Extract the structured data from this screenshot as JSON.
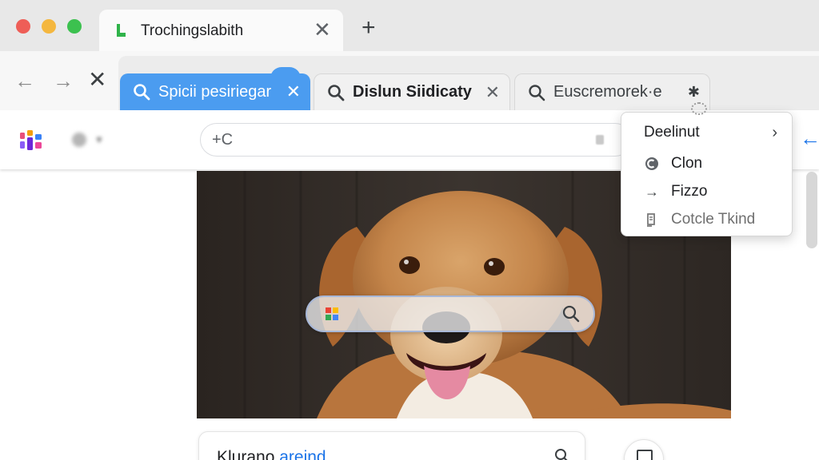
{
  "window": {
    "tab_title": "Trochingslabith",
    "close_symbol": "✕",
    "new_tab_symbol": "+"
  },
  "nav": {
    "back": "←",
    "forward": "→",
    "stop": "✕"
  },
  "page_tabs": [
    {
      "label": "Spicii pesiriegar",
      "close": "✕"
    },
    {
      "label": "Dislun Siidicaty",
      "close": "✕"
    },
    {
      "label": "Euscremorek·e",
      "close": "✱"
    }
  ],
  "toolbar": {
    "omnibox_prefix": "+C",
    "omnibox_value": "",
    "side_back": "←"
  },
  "context_menu": {
    "items": [
      {
        "label": "Deelinut",
        "arrow": "›"
      },
      {
        "label": "Clon",
        "icon": "◐"
      },
      {
        "label": "Fizzo",
        "icon": "→"
      },
      {
        "label": "Cotcle Tkind",
        "icon": "▯"
      }
    ]
  },
  "result_card": {
    "text": "Klurano",
    "link": "areind"
  },
  "colors": {
    "active_tab": "#4b9cf0",
    "accent_link": "#1a73e8",
    "traffic_red": "#ee5e57",
    "traffic_yellow": "#f4b73f",
    "traffic_green": "#3cc14f"
  },
  "icons": {
    "favicon": "green-bar-icon",
    "app_logo": "app-logo-icon",
    "search": "search-icon",
    "google_g": "google-g-icon",
    "menu_clone": "clone-icon",
    "menu_forward": "arrow-right-icon",
    "menu_doc": "document-icon",
    "round_button": "bookmark-icon"
  }
}
